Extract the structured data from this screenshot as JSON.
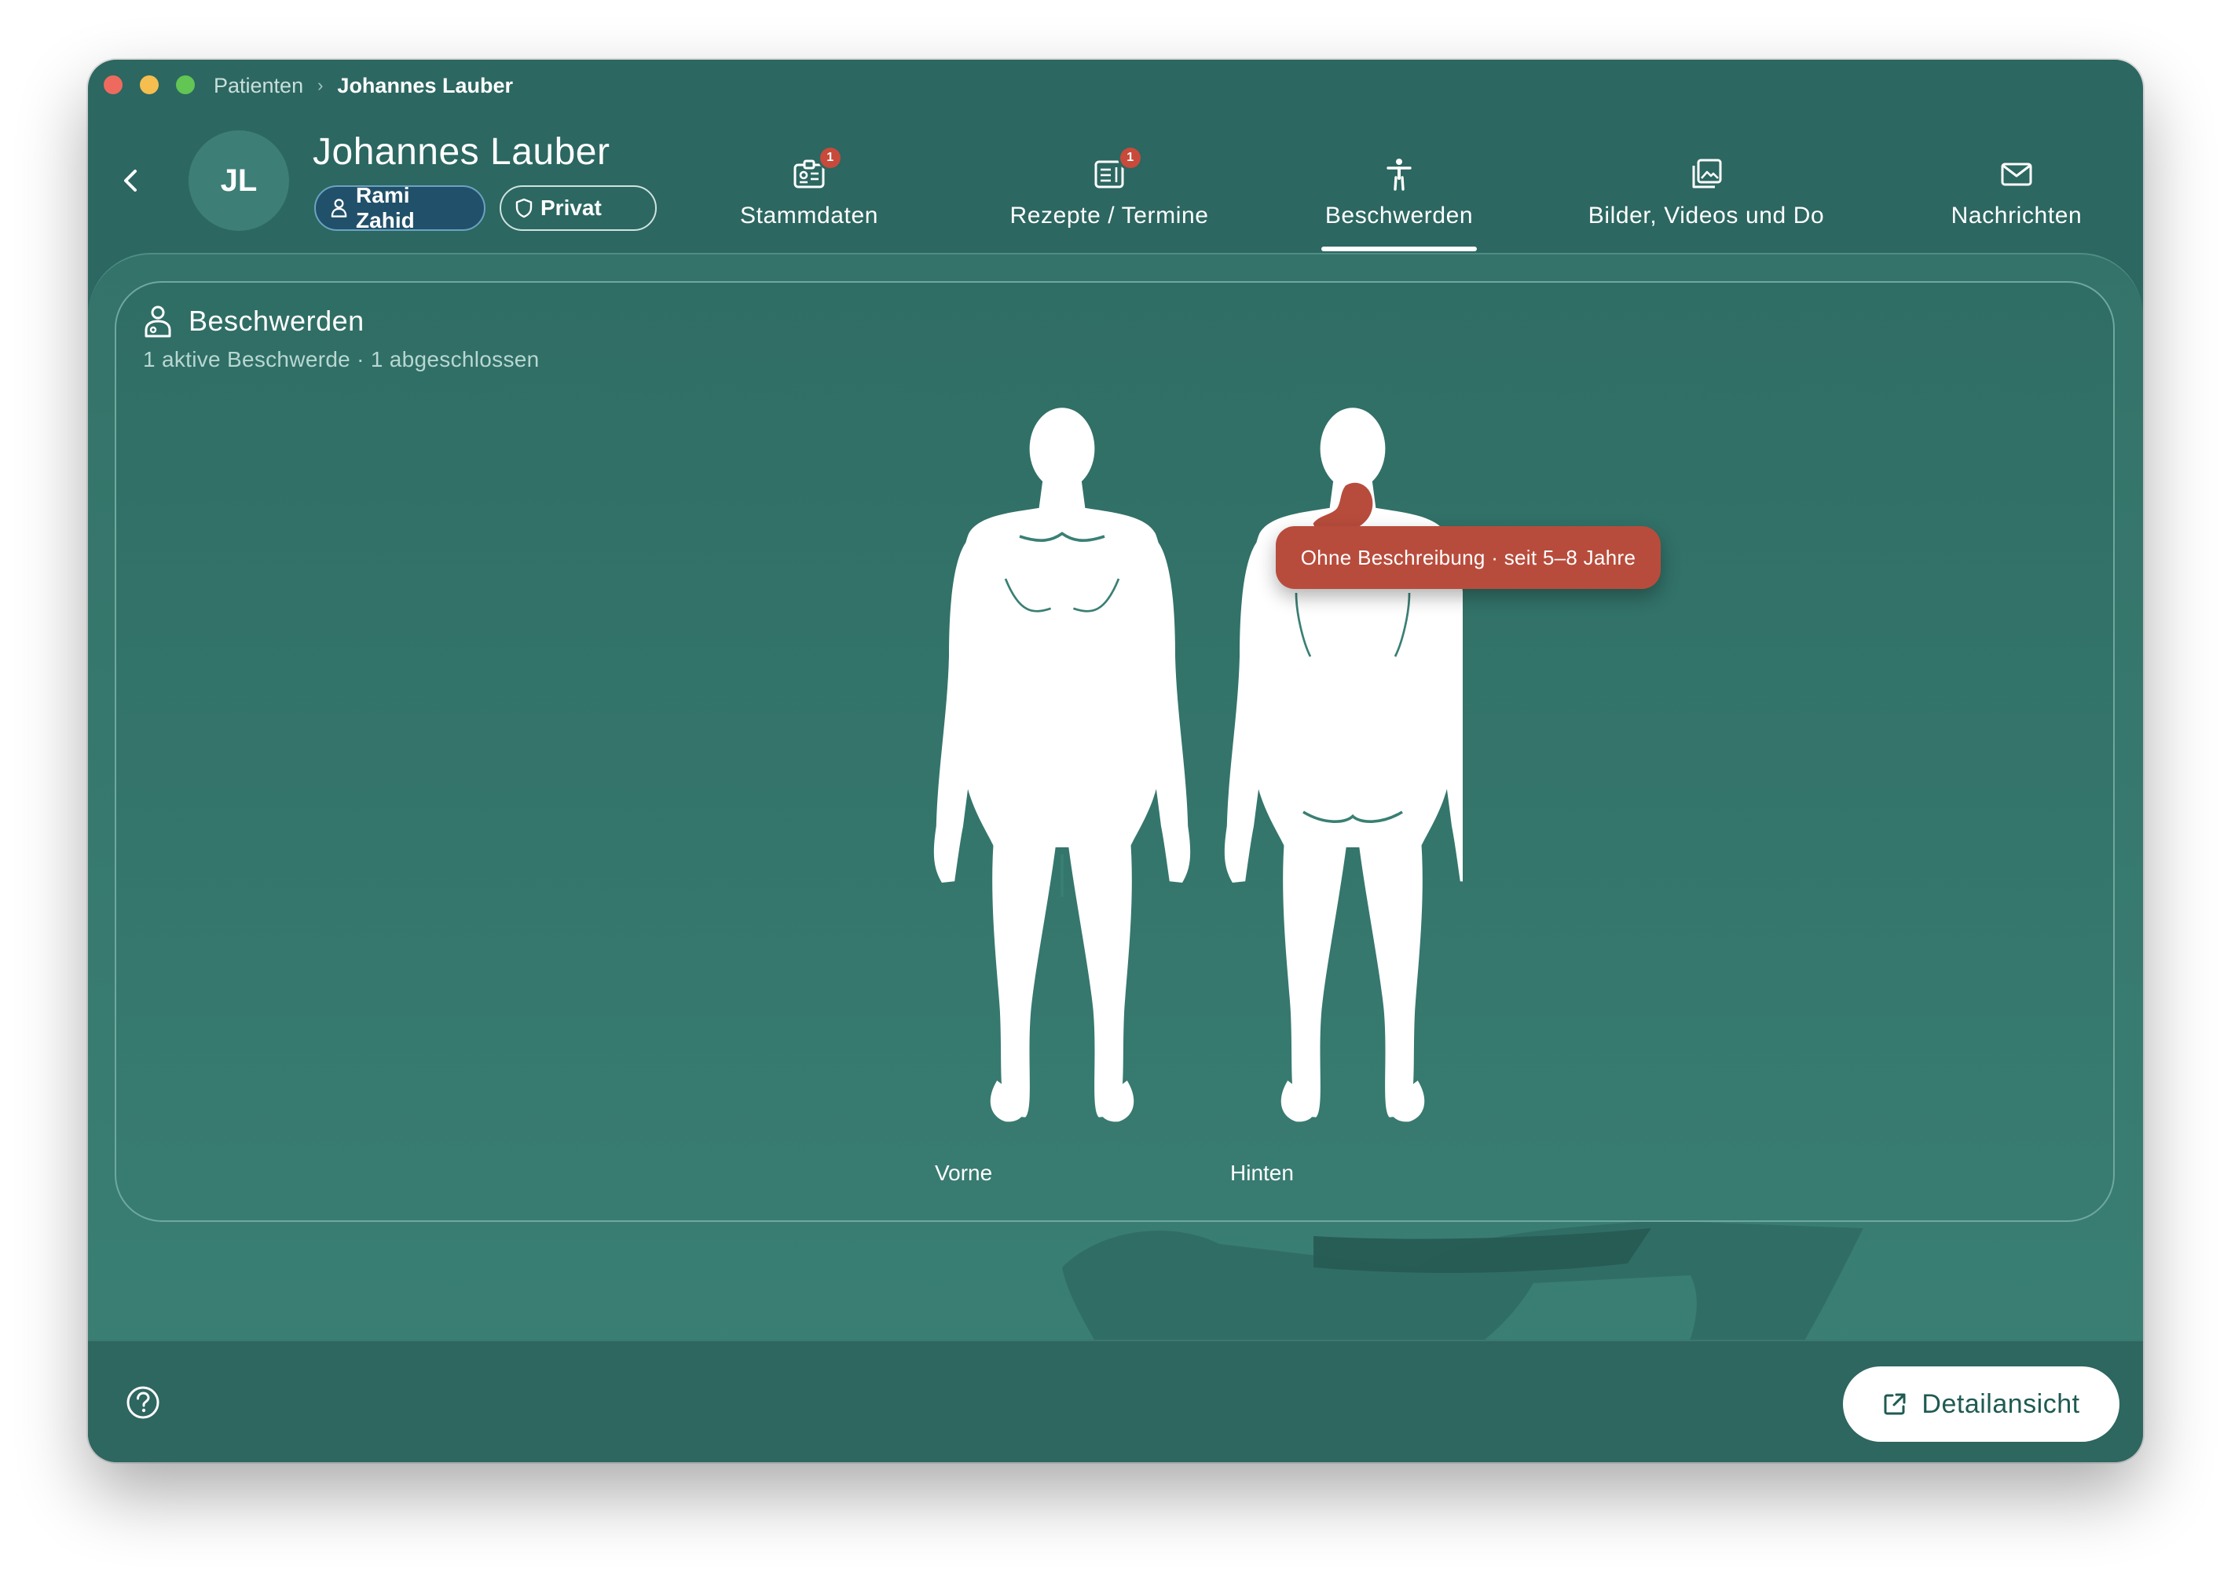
{
  "window": {
    "breadcrumb": {
      "parent": "Patienten",
      "separator": "›",
      "current": "Johannes Lauber"
    }
  },
  "patient": {
    "initials": "JL",
    "name": "Johannes Lauber",
    "doctor": "Rami Zahid",
    "insurance": "Privat"
  },
  "tabs": [
    {
      "label": "Stammdaten",
      "icon": "id-card-icon",
      "badge": "1"
    },
    {
      "label": "Rezepte / Termine",
      "icon": "prescription-icon",
      "badge": "1"
    },
    {
      "label": "Beschwerden",
      "icon": "person-standing-icon",
      "badge": null,
      "active": true
    },
    {
      "label": "Bilder, Videos und Do",
      "icon": "gallery-icon",
      "badge": null
    },
    {
      "label": "Nachrichten",
      "icon": "mail-icon",
      "badge": null
    }
  ],
  "complaints": {
    "title": "Beschwerden",
    "summary": "1 aktive Beschwerde · 1 abgeschlossen",
    "front_label": "Vorne",
    "back_label": "Hinten",
    "marker_tooltip": "Ohne Beschreibung · seit 5–8 Jahre",
    "marker_color": "#b84c3c"
  },
  "footer": {
    "detail_button": "Detailansicht",
    "help_icon": "question-circle-icon"
  },
  "colors": {
    "window_bg": "#2c6761",
    "accent_red": "#c84a3a",
    "card_border": "#6fa89e"
  }
}
